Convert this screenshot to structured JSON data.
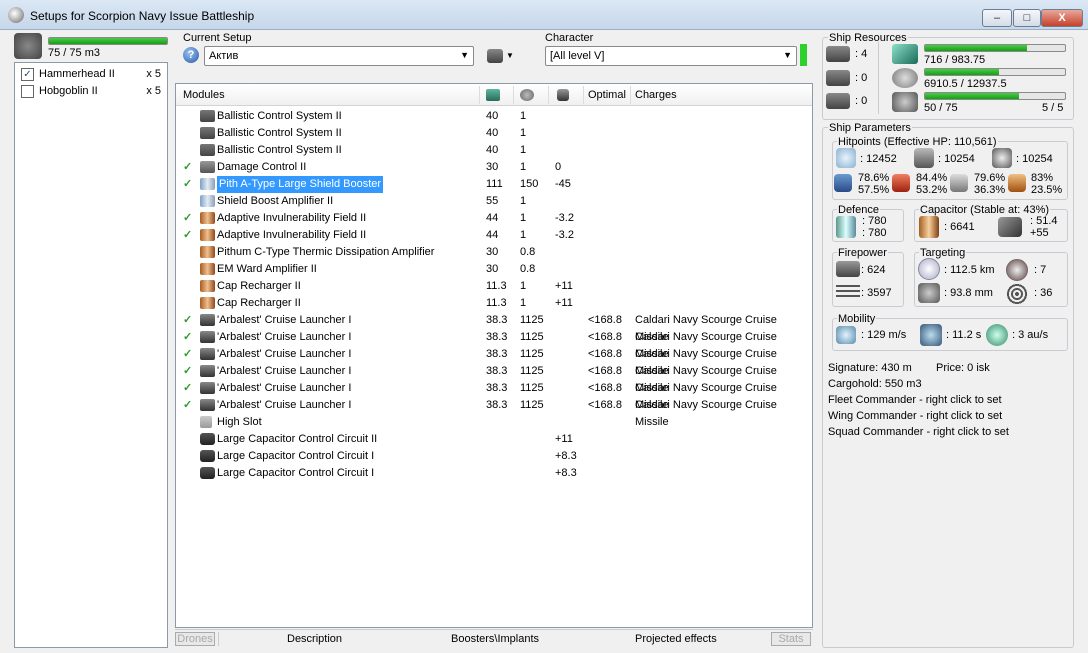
{
  "window": {
    "title": "Setups for Scorpion Navy Issue Battleship",
    "minimize": "–",
    "maximize": "□",
    "close": "X"
  },
  "drones": {
    "bay_text": "75 / 75 m3",
    "bay_fill": 1.0,
    "items": [
      {
        "name": "Hammerhead II",
        "count": "x 5",
        "checked": true
      },
      {
        "name": "Hobgoblin II",
        "count": "x 5",
        "checked": false
      }
    ]
  },
  "setup": {
    "label": "Current Setup",
    "value": "Актив",
    "help": "?"
  },
  "character": {
    "label": "Character",
    "value": "[All level V]"
  },
  "modules": {
    "headers": {
      "name": "Modules",
      "optimal": "Optimal",
      "charges": "Charges"
    },
    "rows": [
      {
        "name": "Ballistic Control System II",
        "c1": "40",
        "c2": "1",
        "c3": "",
        "opt": "",
        "charge": "",
        "icon": "gun",
        "check": false
      },
      {
        "name": "Ballistic Control System II",
        "c1": "40",
        "c2": "1",
        "c3": "",
        "opt": "",
        "charge": "",
        "icon": "gun",
        "check": false
      },
      {
        "name": "Ballistic Control System II",
        "c1": "40",
        "c2": "1",
        "c3": "",
        "opt": "",
        "charge": "",
        "icon": "gun",
        "check": false
      },
      {
        "name": "Damage Control II",
        "c1": "30",
        "c2": "1",
        "c3": "0",
        "opt": "",
        "charge": "",
        "icon": "dmg",
        "check": true
      },
      {
        "name": "Pith A-Type Large Shield Booster",
        "c1": "111",
        "c2": "150",
        "c3": "-45",
        "opt": "",
        "charge": "",
        "icon": "shield",
        "check": true,
        "selected": true
      },
      {
        "name": "Shield Boost Amplifier II",
        "c1": "55",
        "c2": "1",
        "c3": "",
        "opt": "",
        "charge": "",
        "icon": "shield",
        "check": false
      },
      {
        "name": "Adaptive Invulnerability Field II",
        "c1": "44",
        "c2": "1",
        "c3": "-3.2",
        "opt": "",
        "charge": "",
        "icon": "armor",
        "check": true
      },
      {
        "name": "Adaptive Invulnerability Field II",
        "c1": "44",
        "c2": "1",
        "c3": "-3.2",
        "opt": "",
        "charge": "",
        "icon": "armor",
        "check": true
      },
      {
        "name": "Pithum C-Type Thermic Dissipation Amplifier",
        "c1": "30",
        "c2": "0.8",
        "c3": "",
        "opt": "",
        "charge": "",
        "icon": "armor",
        "check": false
      },
      {
        "name": "EM Ward Amplifier II",
        "c1": "30",
        "c2": "0.8",
        "c3": "",
        "opt": "",
        "charge": "",
        "icon": "armor",
        "check": false
      },
      {
        "name": "Cap Recharger II",
        "c1": "11.3",
        "c2": "1",
        "c3": "+11",
        "opt": "",
        "charge": "",
        "icon": "armor",
        "check": false
      },
      {
        "name": "Cap Recharger II",
        "c1": "11.3",
        "c2": "1",
        "c3": "+11",
        "opt": "",
        "charge": "",
        "icon": "armor",
        "check": false
      },
      {
        "name": "'Arbalest' Cruise Launcher I",
        "c1": "38.3",
        "c2": "1125",
        "c3": "",
        "opt": "<168.8",
        "charge": "Caldari Navy Scourge Cruise Missile",
        "icon": "launcher",
        "check": true
      },
      {
        "name": "'Arbalest' Cruise Launcher I",
        "c1": "38.3",
        "c2": "1125",
        "c3": "",
        "opt": "<168.8",
        "charge": "Caldari Navy Scourge Cruise Missile",
        "icon": "launcher",
        "check": true
      },
      {
        "name": "'Arbalest' Cruise Launcher I",
        "c1": "38.3",
        "c2": "1125",
        "c3": "",
        "opt": "<168.8",
        "charge": "Caldari Navy Scourge Cruise Missile",
        "icon": "launcher",
        "check": true
      },
      {
        "name": "'Arbalest' Cruise Launcher I",
        "c1": "38.3",
        "c2": "1125",
        "c3": "",
        "opt": "<168.8",
        "charge": "Caldari Navy Scourge Cruise Missile",
        "icon": "launcher",
        "check": true
      },
      {
        "name": "'Arbalest' Cruise Launcher I",
        "c1": "38.3",
        "c2": "1125",
        "c3": "",
        "opt": "<168.8",
        "charge": "Caldari Navy Scourge Cruise Missile",
        "icon": "launcher",
        "check": true
      },
      {
        "name": "'Arbalest' Cruise Launcher I",
        "c1": "38.3",
        "c2": "1125",
        "c3": "",
        "opt": "<168.8",
        "charge": "Caldari Navy Scourge Cruise Missile",
        "icon": "launcher",
        "check": true
      },
      {
        "name": "High Slot",
        "c1": "",
        "c2": "",
        "c3": "",
        "opt": "",
        "charge": "",
        "icon": "slot",
        "check": false
      },
      {
        "name": "Large Capacitor Control Circuit II",
        "c1": "",
        "c2": "",
        "c3": "+11",
        "opt": "",
        "charge": "",
        "icon": "cap",
        "check": false
      },
      {
        "name": "Large Capacitor Control Circuit I",
        "c1": "",
        "c2": "",
        "c3": "+8.3",
        "opt": "",
        "charge": "",
        "icon": "cap",
        "check": false
      },
      {
        "name": "Large Capacitor Control Circuit I",
        "c1": "",
        "c2": "",
        "c3": "+8.3",
        "opt": "",
        "charge": "",
        "icon": "cap",
        "check": false
      }
    ]
  },
  "bottom_tabs": {
    "drones": "Drones",
    "description": "Description",
    "boosters": "Boosters\\Implants",
    "projected": "Projected effects",
    "stats": "Stats"
  },
  "resources": {
    "label": "Ship Resources",
    "slots": {
      "turret": ": 4",
      "launcher": ": 0",
      "drone": ": 0"
    },
    "cpu": {
      "text": "716 / 983.75",
      "fill": 0.73
    },
    "power": {
      "text": "6910.5 / 12937.5",
      "fill": 0.53
    },
    "bandwidth": {
      "text": "50 / 75",
      "extra": "5 / 5",
      "fill": 0.67
    }
  },
  "params": {
    "label": "Ship Parameters",
    "hitpoints": {
      "label": "Hitpoints (Effective HP: 110,561)",
      "shield": ": 12452",
      "armor": ": 10254",
      "structure": ": 10254",
      "res_shield": [
        "78.6%",
        "57.5%"
      ],
      "res_armor": [
        "84.4%",
        "53.2%"
      ],
      "res_kin": [
        "79.6%",
        "36.3%"
      ],
      "res_exp": [
        "83%",
        "23.5%"
      ]
    },
    "defence": {
      "label": "Defence",
      "v1": ": 780",
      "v2": ": 780"
    },
    "capacitor": {
      "label": "Capacitor (Stable at: 43%)",
      "amount": ": 6641",
      "v1": ": 51.4",
      "v2": "+55"
    },
    "firepower": {
      "label": "Firepower",
      "dps": ": 624",
      "volley": ": 3597"
    },
    "targeting": {
      "label": "Targeting",
      "range": ": 112.5 km",
      "targets": ": 7",
      "scan": ": 93.8 mm",
      "sig": ": 36"
    },
    "mobility": {
      "label": "Mobility",
      "speed": ": 129 m/s",
      "align": ": 11.2 s",
      "warp": ": 3 au/s"
    },
    "signature": "Signature: 430 m",
    "price": "Price: 0 isk",
    "cargohold": "Cargohold: 550 m3",
    "fleet": "Fleet Commander - right click to set",
    "wing": "Wing Commander - right click to set",
    "squad": "Squad Commander - right click to set"
  }
}
